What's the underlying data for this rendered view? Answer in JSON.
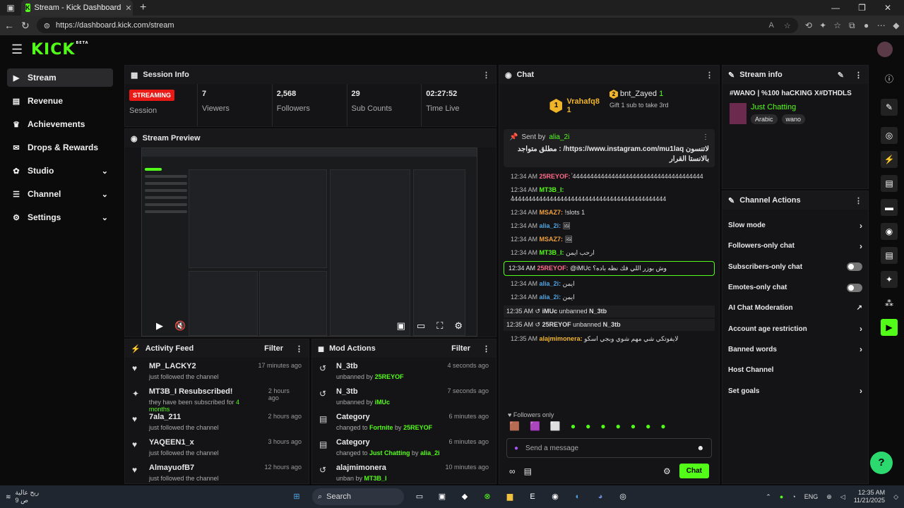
{
  "browser": {
    "tab_title": "Stream - Kick Dashboard",
    "url": "https://dashboard.kick.com/stream"
  },
  "brand": {
    "logo": "KICK",
    "beta": "BETA",
    "accent": "#53fc18"
  },
  "sidebar": {
    "items": [
      {
        "label": "Stream",
        "icon": "video-icon"
      },
      {
        "label": "Revenue",
        "icon": "chart-icon"
      },
      {
        "label": "Achievements",
        "icon": "trophy-icon"
      },
      {
        "label": "Drops & Rewards",
        "icon": "gift-icon"
      },
      {
        "label": "Studio",
        "icon": "gear-icon"
      },
      {
        "label": "Channel",
        "icon": "user-icon"
      },
      {
        "label": "Settings",
        "icon": "cog-icon"
      }
    ]
  },
  "session": {
    "title": "Session Info",
    "streaming": "STREAMING",
    "session_label": "Session",
    "stats": [
      {
        "v": "7",
        "l": "Viewers"
      },
      {
        "v": "2,568",
        "l": "Followers"
      },
      {
        "v": "29",
        "l": "Sub Counts"
      },
      {
        "v": "02:27:52",
        "l": "Time Live"
      }
    ]
  },
  "preview": {
    "title": "Stream Preview"
  },
  "activity": {
    "title": "Activity Feed",
    "filter": "Filter",
    "items": [
      {
        "name": "MP_LACKY2",
        "desc": "just followed the channel",
        "time": "17 minutes ago",
        "icon": "heart-icon"
      },
      {
        "name": "MT3B_I Resubscribed!",
        "desc_pre": "they have been subscribed for ",
        "desc_hl": "4 months",
        "time": "2 hours ago",
        "icon": "sparkle-icon"
      },
      {
        "name": "7ala_211",
        "desc": "just followed the channel",
        "time": "2 hours ago",
        "icon": "heart-icon"
      },
      {
        "name": "YAQEEN1_x",
        "desc": "just followed the channel",
        "time": "3 hours ago",
        "icon": "heart-icon"
      },
      {
        "name": "AlmayuofB7",
        "desc": "just followed the channel",
        "time": "12 hours ago",
        "icon": "heart-icon"
      }
    ]
  },
  "mod": {
    "title": "Mod Actions",
    "filter": "Filter",
    "items": [
      {
        "name": "N_3tb",
        "pre": "unbanned by ",
        "who": "25REYOF",
        "time": "4 seconds ago"
      },
      {
        "name": "N_3tb",
        "pre": "unbanned by ",
        "who": "iMUc",
        "time": "7 seconds ago"
      },
      {
        "name": "Category",
        "pre": "changed to ",
        "mid": "Fortnite",
        "by": " by ",
        "who": "25REYOF",
        "time": "6 minutes ago"
      },
      {
        "name": "Category",
        "pre": "changed to ",
        "mid": "Just Chatting",
        "by": " by ",
        "who": "alia_2i",
        "time": "6 minutes ago"
      },
      {
        "name": "alajmimonera",
        "pre": "unban by ",
        "who": "MT3B_I",
        "time": "10 minutes ago"
      }
    ]
  },
  "chat": {
    "title": "Chat",
    "top1": "Vrahafq8",
    "top1n": "1",
    "top2": "bnt_Zayed",
    "top2n": "1",
    "gift": "Gift 1 sub to take 3rd",
    "pinned_sent": "Sent by",
    "pinned_user": "alia_2i",
    "pinned_text": "لاتنسون https://www.instagram.com/mu1laq/ : مطلق متواجد بالانستا القرار",
    "messages": [
      {
        "t": "12:34 AM",
        "n": "25REYOF:",
        "c": "#ff6b8a",
        "m": "ٰ4444444444444444444444444444444444444"
      },
      {
        "t": "12:34 AM",
        "n": "MT3B_I:",
        "c": "#53fc18",
        "m": "ٰ44444444444444444444444444444444444444444444"
      },
      {
        "t": "12:34 AM",
        "n": "MSAZ7:",
        "c": "#f0a040",
        "m": "!slots 1"
      },
      {
        "t": "12:34 AM",
        "n": "alia_2i:",
        "c": "#4fa3e0",
        "m": ""
      },
      {
        "t": "12:34 AM",
        "n": "MSAZ7:",
        "c": "#f0a040",
        "m": ""
      },
      {
        "t": "12:34 AM",
        "n": "MT3B_I:",
        "c": "#53fc18",
        "m": "ارحب ايمن"
      }
    ],
    "hl": {
      "t": "12:34 AM",
      "n": "25REYOF:",
      "m": "@iMUc وش بوزر اللي فك نظه باده؟"
    },
    "messages2": [
      {
        "t": "12:34 AM",
        "n": "alia_2i:",
        "c": "#4fa3e0",
        "m": "ايمن"
      },
      {
        "t": "12:34 AM",
        "n": "alia_2i:",
        "c": "#4fa3e0",
        "m": "ايمن"
      }
    ],
    "sys": [
      {
        "t": "12:35 AM",
        "a": "iMUc",
        "b": "unbanned",
        "c": "N_3tb"
      },
      {
        "t": "12:35 AM",
        "a": "25REYOF",
        "b": "unbanned",
        "c": "N_3tb"
      }
    ],
    "last": {
      "t": "12:35 AM",
      "n": "alajmimonera:",
      "m": "لايفوتكي شي مهم شوي وبجي اسكو"
    },
    "followers_only": "Followers only",
    "placeholder": "Send a message",
    "send": "Chat"
  },
  "info": {
    "title": "Stream info",
    "stream_title": "#WANO | %100 haCKING X#DTHDLS",
    "category": "Just Chatting",
    "tags": [
      "Arabic",
      "wano"
    ]
  },
  "actions": {
    "title": "Channel Actions",
    "items": [
      {
        "label": "Slow mode",
        "type": "chev"
      },
      {
        "label": "Followers-only chat",
        "type": "chev"
      },
      {
        "label": "Subscribers-only chat",
        "type": "toggle"
      },
      {
        "label": "Emotes-only chat",
        "type": "toggle"
      },
      {
        "label": "AI Chat Moderation",
        "type": "ext"
      },
      {
        "label": "Account age restriction",
        "type": "chev"
      },
      {
        "label": "Banned words",
        "type": "chev"
      },
      {
        "label": "Host Channel",
        "type": "none"
      },
      {
        "label": "Set goals",
        "type": "chev"
      }
    ]
  },
  "taskbar": {
    "weather1": "ريح عالية",
    "weather2": "9 ص",
    "search": "Search",
    "lang": "ENG",
    "time": "12:35 AM",
    "date": "11/21/2025"
  }
}
